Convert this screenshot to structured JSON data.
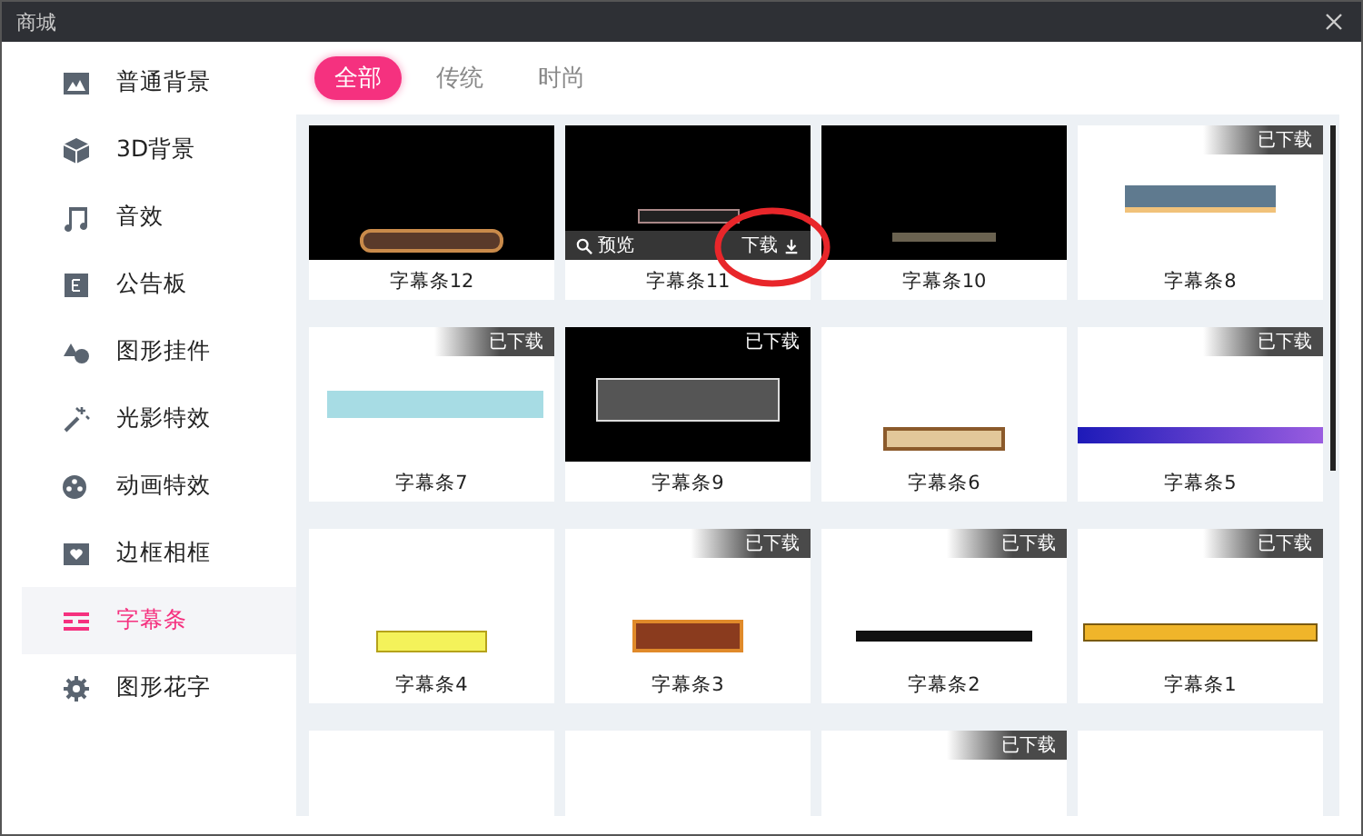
{
  "window": {
    "title": "商城"
  },
  "sidebar": {
    "items": [
      {
        "label": "普通背景",
        "selected": false
      },
      {
        "label": "3D背景",
        "selected": false
      },
      {
        "label": "音效",
        "selected": false
      },
      {
        "label": "公告板",
        "selected": false
      },
      {
        "label": "图形挂件",
        "selected": false
      },
      {
        "label": "光影特效",
        "selected": false
      },
      {
        "label": "动画特效",
        "selected": false
      },
      {
        "label": "边框相框",
        "selected": false
      },
      {
        "label": "字幕条",
        "selected": true
      },
      {
        "label": "图形花字",
        "selected": false
      }
    ]
  },
  "tabs": [
    {
      "label": "全部",
      "selected": true
    },
    {
      "label": "传统",
      "selected": false
    },
    {
      "label": "时尚",
      "selected": false
    }
  ],
  "cards": [
    {
      "name": "字幕条12",
      "downloaded": false
    },
    {
      "name": "字幕条11",
      "downloaded": false,
      "preview": "预览",
      "download": "下载"
    },
    {
      "name": "字幕条10",
      "downloaded": false
    },
    {
      "name": "字幕条8",
      "downloaded": true,
      "badge": "已下载"
    },
    {
      "name": "字幕条7",
      "downloaded": true,
      "badge": "已下载"
    },
    {
      "name": "字幕条9",
      "downloaded": true,
      "badge": "已下载"
    },
    {
      "name": "字幕条6",
      "downloaded": false
    },
    {
      "name": "字幕条5",
      "downloaded": true,
      "badge": "已下载"
    },
    {
      "name": "字幕条4",
      "downloaded": false
    },
    {
      "name": "字幕条3",
      "downloaded": true,
      "badge": "已下载"
    },
    {
      "name": "字幕条2",
      "downloaded": true,
      "badge": "已下载"
    },
    {
      "name": "字幕条1",
      "downloaded": true,
      "badge": "已下载"
    },
    {
      "downloaded": false
    },
    {
      "downloaded": false
    },
    {
      "downloaded": true,
      "badge": "已下载"
    },
    {
      "downloaded": false
    }
  ]
}
